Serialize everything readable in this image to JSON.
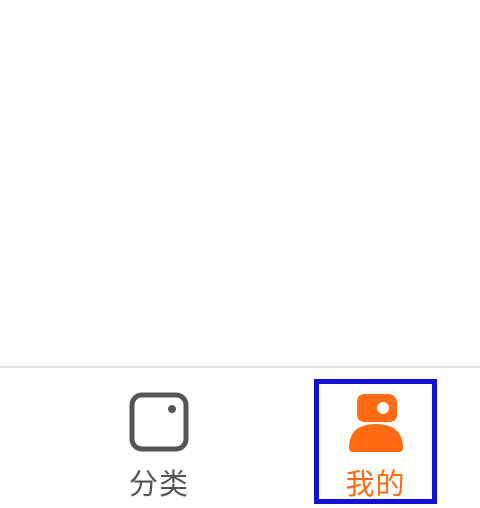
{
  "tabbar": {
    "items": [
      {
        "label": "分类",
        "icon": "category-square-icon",
        "active": false,
        "color": "#555555"
      },
      {
        "label": "我的",
        "icon": "profile-user-icon",
        "active": true,
        "color": "#ff6a13"
      }
    ]
  },
  "colors": {
    "accent": "#ff6a13",
    "inactive": "#555555",
    "highlight_box": "#1212d6",
    "divider": "#e3e3e3"
  }
}
